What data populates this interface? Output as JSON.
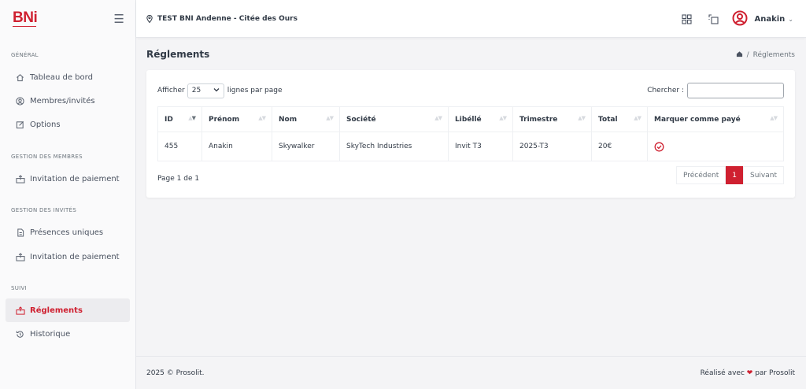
{
  "brand": {
    "logo_text": "BNi",
    "accent_color": "#cf2030"
  },
  "sidebar": {
    "sections": [
      {
        "title": "GÉNÉRAL"
      },
      {
        "title": "GESTION DES MEMBRES"
      },
      {
        "title": "GESTION DES INVITÉS"
      },
      {
        "title": "SUIVI"
      }
    ],
    "items": [
      {
        "label": "Tableau de bord",
        "icon": "home-icon"
      },
      {
        "label": "Membres/invités",
        "icon": "user-circle-icon"
      },
      {
        "label": "Options",
        "icon": "edit-icon"
      },
      {
        "label": "Invitation de paiement",
        "icon": "cash-icon"
      },
      {
        "label": "Présences uniques",
        "icon": "document-icon"
      },
      {
        "label": "Invitation de paiement",
        "icon": "cash-icon"
      },
      {
        "label": "Réglements",
        "icon": "cash-icon",
        "active": true
      },
      {
        "label": "Historique",
        "icon": "history-icon"
      }
    ]
  },
  "topbar": {
    "club_name": "TEST BNI Andenne - Citée des Ours",
    "user_name": "Anakin"
  },
  "page": {
    "title": "Réglements",
    "breadcrumb_current": "Réglements"
  },
  "table_controls": {
    "show_label": "Afficher",
    "page_length": "25",
    "per_page_label": "lignes par page",
    "search_label": "Chercher :",
    "search_value": ""
  },
  "table": {
    "columns": [
      "ID",
      "Prénom",
      "Nom",
      "Société",
      "Libéllé",
      "Trimestre",
      "Total",
      "Marquer comme payé"
    ],
    "rows": [
      [
        "455",
        "Anakin",
        "Skywalker",
        "SkyTech Industries",
        "Invit T3",
        "2025-T3",
        "20€",
        ""
      ]
    ]
  },
  "pagination": {
    "info": "Page 1 de 1",
    "prev": "Précédent",
    "current": "1",
    "next": "Suivant"
  },
  "footer": {
    "copyright": "2025 © Prosolit.",
    "credit_before": "Réalisé avec",
    "credit_after": "par Prosolit"
  }
}
